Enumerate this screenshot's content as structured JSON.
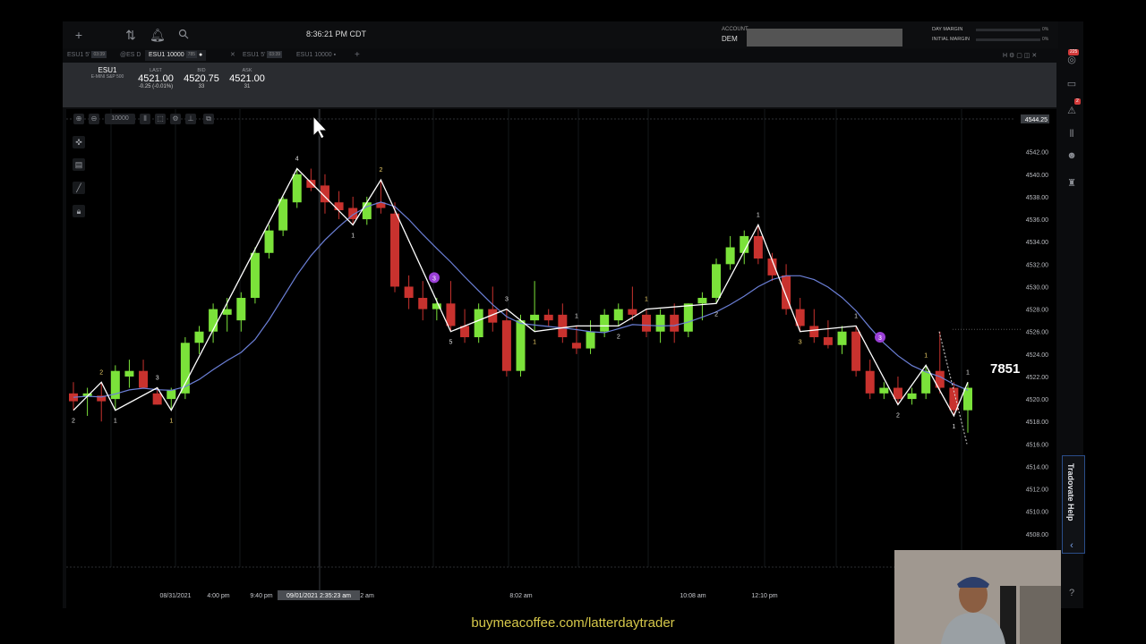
{
  "topbar": {
    "clock": "8:36:21 PM CDT",
    "account_label": "ACCOUNT",
    "account_value": "DEM",
    "day_margin_label": "DAY MARGIN",
    "day_margin_pct": "0%",
    "initial_margin_label": "INITIAL MARGIN",
    "initial_margin_pct": "0%"
  },
  "tabs": [
    {
      "label": "ESU1 5'",
      "tag": "03:39"
    },
    {
      "label": "@ES D",
      "tag": ""
    },
    {
      "label": "ESU1 10000",
      "tag": "785"
    },
    {
      "label": "ESU1 5'",
      "tag": "03:39"
    },
    {
      "label": "ESU1 10000",
      "tag": ""
    }
  ],
  "quote": {
    "symbol": "ESU1",
    "description": "E-MINI S&P 500",
    "last_label": "LAST",
    "last_value": "4521.00",
    "last_change": "-0.25 (-0.01%)",
    "bid_label": "BID",
    "bid_value": "4520.75",
    "bid_size": "33",
    "ask_label": "ASK",
    "ask_value": "4521.00",
    "ask_size": "31"
  },
  "chart_toolbar": {
    "interval": "10000"
  },
  "chart_data": {
    "type": "candlestick",
    "price_axis": [
      "4544.25",
      "4542.00",
      "4540.00",
      "4538.00",
      "4536.00",
      "4534.00",
      "4532.00",
      "4530.00",
      "4528.00",
      "4526.00",
      "4524.00",
      "4522.00",
      "4520.00",
      "4518.00",
      "4516.00",
      "4514.00",
      "4512.00",
      "4510.00",
      "4508.00"
    ],
    "y_range": [
      4506,
      4545
    ],
    "time_labels": [
      "08/31/2021",
      "4:00 pm",
      "9:40 pm",
      "09/01/2021 2:35:23 am",
      "2 am",
      "8:02 am",
      "10:08 am",
      "12:10 pm"
    ],
    "current_price_tag": "4544.25",
    "candles": [
      [
        4520.5,
        4521.5,
        4519.0,
        4519.8
      ],
      [
        4520.2,
        4521.0,
        4518.5,
        4520.5
      ],
      [
        4520.3,
        4521.5,
        4518.0,
        4519.8
      ],
      [
        4520.0,
        4523.0,
        4519.0,
        4522.5
      ],
      [
        4522.0,
        4523.5,
        4521.0,
        4522.5
      ],
      [
        4522.5,
        4523.5,
        4521.0,
        4521.0
      ],
      [
        4520.5,
        4521.0,
        4519.5,
        4519.5
      ],
      [
        4520.0,
        4521.0,
        4519.0,
        4520.8
      ],
      [
        4520.5,
        4525.5,
        4520.0,
        4525.0
      ],
      [
        4525.0,
        4526.5,
        4524.0,
        4526.0
      ],
      [
        4526.0,
        4528.5,
        4525.0,
        4528.0
      ],
      [
        4527.5,
        4529.0,
        4526.0,
        4528.0
      ],
      [
        4527.0,
        4529.5,
        4526.0,
        4529.0
      ],
      [
        4529.0,
        4533.5,
        4528.5,
        4533.0
      ],
      [
        4533.0,
        4535.5,
        4532.5,
        4535.0
      ],
      [
        4535.0,
        4538.0,
        4534.5,
        4537.8
      ],
      [
        4537.5,
        4540.5,
        4537.0,
        4540.0
      ],
      [
        4539.5,
        4540.5,
        4538.5,
        4538.8
      ],
      [
        4539.0,
        4540.0,
        4536.5,
        4537.5
      ],
      [
        4537.5,
        4538.5,
        4536.0,
        4536.8
      ],
      [
        4537.0,
        4538.0,
        4535.5,
        4536.0
      ],
      [
        4536.0,
        4538.0,
        4535.5,
        4537.5
      ],
      [
        4537.5,
        4539.5,
        4536.5,
        4537.0
      ],
      [
        4536.5,
        4537.5,
        4529.5,
        4530.0
      ],
      [
        4530.0,
        4531.0,
        4528.0,
        4529.0
      ],
      [
        4529.0,
        4530.5,
        4527.0,
        4528.0
      ],
      [
        4528.0,
        4529.0,
        4527.0,
        4528.5
      ],
      [
        4528.5,
        4530.5,
        4526.0,
        4526.5
      ],
      [
        4526.5,
        4528.0,
        4525.0,
        4525.5
      ],
      [
        4525.5,
        4528.5,
        4525.0,
        4528.0
      ],
      [
        4528.0,
        4530.0,
        4526.0,
        4526.8
      ],
      [
        4527.0,
        4528.0,
        4522.0,
        4522.5
      ],
      [
        4522.5,
        4527.5,
        4522.0,
        4527.0
      ],
      [
        4527.0,
        4530.5,
        4526.0,
        4527.5
      ],
      [
        4527.5,
        4528.0,
        4526.5,
        4527.0
      ],
      [
        4527.5,
        4528.5,
        4525.0,
        4525.5
      ],
      [
        4525.0,
        4526.5,
        4524.0,
        4524.5
      ],
      [
        4524.5,
        4527.0,
        4524.0,
        4526.0
      ],
      [
        4526.0,
        4528.0,
        4525.5,
        4527.5
      ],
      [
        4527.0,
        4528.5,
        4526.5,
        4528.0
      ],
      [
        4528.0,
        4530.0,
        4527.0,
        4527.5
      ],
      [
        4527.5,
        4528.0,
        4525.5,
        4526.0
      ],
      [
        4526.0,
        4528.0,
        4525.0,
        4527.5
      ],
      [
        4527.5,
        4528.5,
        4525.0,
        4526.0
      ],
      [
        4526.0,
        4528.5,
        4525.5,
        4528.5
      ],
      [
        4528.5,
        4529.5,
        4527.0,
        4529.0
      ],
      [
        4529.0,
        4532.5,
        4528.5,
        4532.0
      ],
      [
        4532.0,
        4534.5,
        4531.5,
        4533.5
      ],
      [
        4533.0,
        4535.0,
        4532.0,
        4534.5
      ],
      [
        4534.5,
        4535.5,
        4532.0,
        4532.5
      ],
      [
        4532.5,
        4533.0,
        4530.5,
        4531.0
      ],
      [
        4531.0,
        4532.0,
        4527.5,
        4528.0
      ],
      [
        4528.0,
        4529.0,
        4526.0,
        4526.5
      ],
      [
        4526.5,
        4528.0,
        4525.0,
        4525.5
      ],
      [
        4525.5,
        4527.0,
        4524.5,
        4524.8
      ],
      [
        4524.8,
        4526.5,
        4524.0,
        4526.0
      ],
      [
        4526.0,
        4526.5,
        4522.0,
        4522.5
      ],
      [
        4522.5,
        4523.5,
        4520.0,
        4520.5
      ],
      [
        4520.5,
        4521.5,
        4520.0,
        4521.0
      ],
      [
        4521.0,
        4522.0,
        4519.5,
        4520.0
      ],
      [
        4520.0,
        4521.0,
        4519.5,
        4520.5
      ],
      [
        4520.5,
        4523.0,
        4520.0,
        4522.5
      ],
      [
        4522.5,
        4526.0,
        4520.5,
        4521.0
      ],
      [
        4521.0,
        4521.5,
        4518.5,
        4519.0
      ],
      [
        4519.0,
        4521.5,
        4517.0,
        4521.0
      ]
    ],
    "zigzag_labels": [
      "2",
      "2",
      "1",
      "3",
      "1",
      "4",
      "1",
      "2",
      "5",
      "3",
      "1",
      "1",
      "2",
      "1",
      "2",
      "1",
      "3",
      "1",
      "2",
      "1",
      "1",
      "1"
    ],
    "annotations": [
      "3",
      "3"
    ]
  },
  "overlay": {
    "big_number": "7851"
  },
  "right_rail": {
    "badge1": "225",
    "badge2": "2",
    "help_label": "Tradovate Help"
  },
  "footer_link": "buymeacoffee.com/latterdaytrader"
}
